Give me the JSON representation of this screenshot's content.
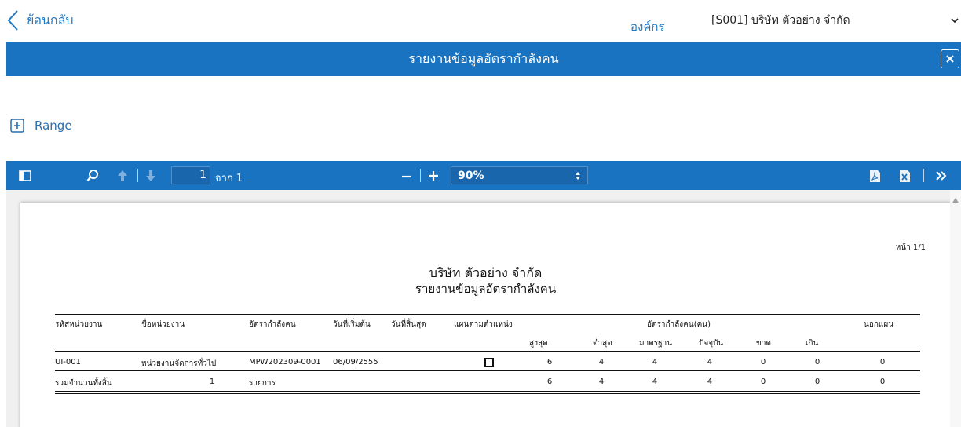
{
  "nav": {
    "back_label": "ย้อนกลับ"
  },
  "org": {
    "label": "องค์กร",
    "selected": "[S001] บริษัท ตัวอย่าง จำกัด"
  },
  "title": "รายงานข้อมูลอัตรากำลังคน",
  "range": {
    "label": "Range"
  },
  "viewer": {
    "page_current": "1",
    "page_of": "จาก 1",
    "zoom": "90%"
  },
  "report": {
    "page_no": "หน้า 1/1",
    "company": "บริษัท ตัวอย่าง จำกัด",
    "subtitle": "รายงานข้อมูลอัตรากำลังคน",
    "headers": {
      "unit_code": "รหัสหน่วยงาน",
      "unit_name": "ชื่อหน่วยงาน",
      "rate": "อัตรากำลังคน",
      "start_date": "วันที่เริ่มต้น",
      "end_date": "วันที่สิ้นสุด",
      "plan_by_position": "แผนตามตำแหน่ง",
      "manpower_group": "อัตรากำลังคน(คน)",
      "out_of_plan": "นอกแผน",
      "max": "สูงสุด",
      "min": "ต่ำสุด",
      "standard": "มาตรฐาน",
      "current": "ปัจจุบัน",
      "short": "ขาด",
      "over": "เกิน"
    },
    "rows": [
      {
        "unit_code": "UI-001",
        "unit_name": "หน่วยงานจัดการทั่วไป",
        "rate": "MPW202309-0001",
        "start_date": "06/09/2555",
        "end_date": "",
        "max": "6",
        "min": "4",
        "standard": "4",
        "current": "4",
        "short": "0",
        "over": "0",
        "out_of_plan": "0"
      }
    ],
    "total": {
      "label": "รวมจำนวนทั้งสิ้น",
      "count": "1",
      "unit": "รายการ",
      "max": "6",
      "min": "4",
      "standard": "4",
      "current": "4",
      "short": "0",
      "over": "0",
      "out_of_plan": "0"
    }
  },
  "colors": {
    "brand": "#1a73c1",
    "link": "#1f78c4"
  }
}
